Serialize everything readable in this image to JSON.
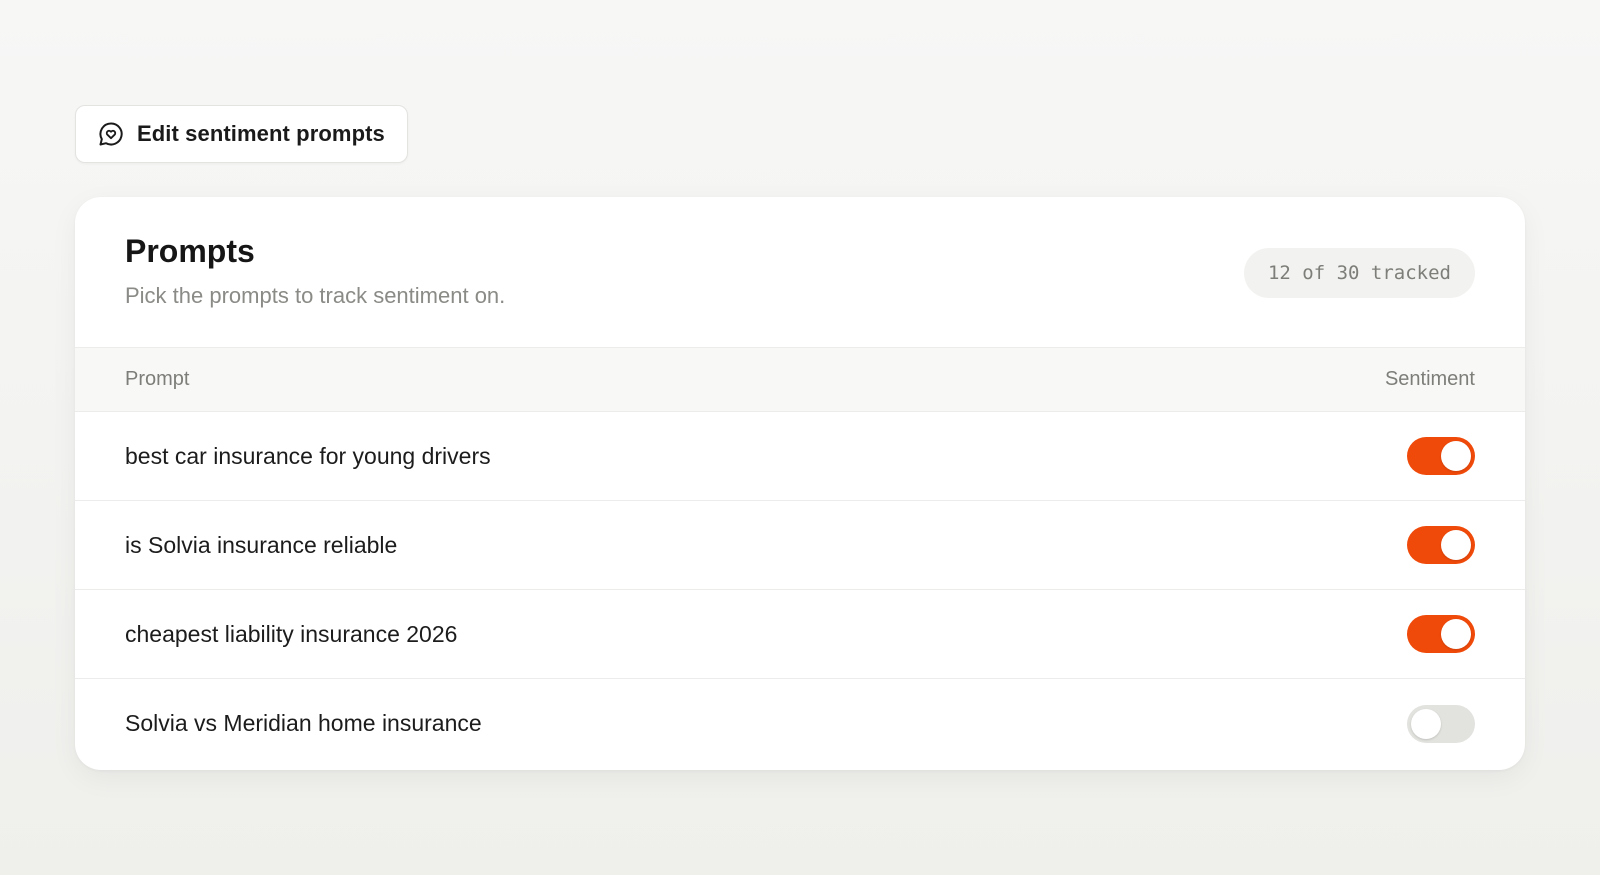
{
  "edit_button": {
    "label": "Edit sentiment prompts",
    "icon": "chat-heart-icon"
  },
  "card": {
    "title": "Prompts",
    "subtitle": "Pick the prompts to track sentiment on.",
    "tracked_badge": "12 of 30 tracked"
  },
  "table": {
    "columns": [
      "Prompt",
      "Sentiment"
    ],
    "rows": [
      {
        "prompt": "best car insurance for young drivers",
        "sentiment_on": true
      },
      {
        "prompt": "is Solvia insurance reliable",
        "sentiment_on": true
      },
      {
        "prompt": "cheapest liability insurance 2026",
        "sentiment_on": true
      },
      {
        "prompt": "Solvia vs Meridian home insurance",
        "sentiment_on": false
      }
    ]
  },
  "colors": {
    "accent": "#f04a0a",
    "toggle_off": "#e2e2df"
  }
}
